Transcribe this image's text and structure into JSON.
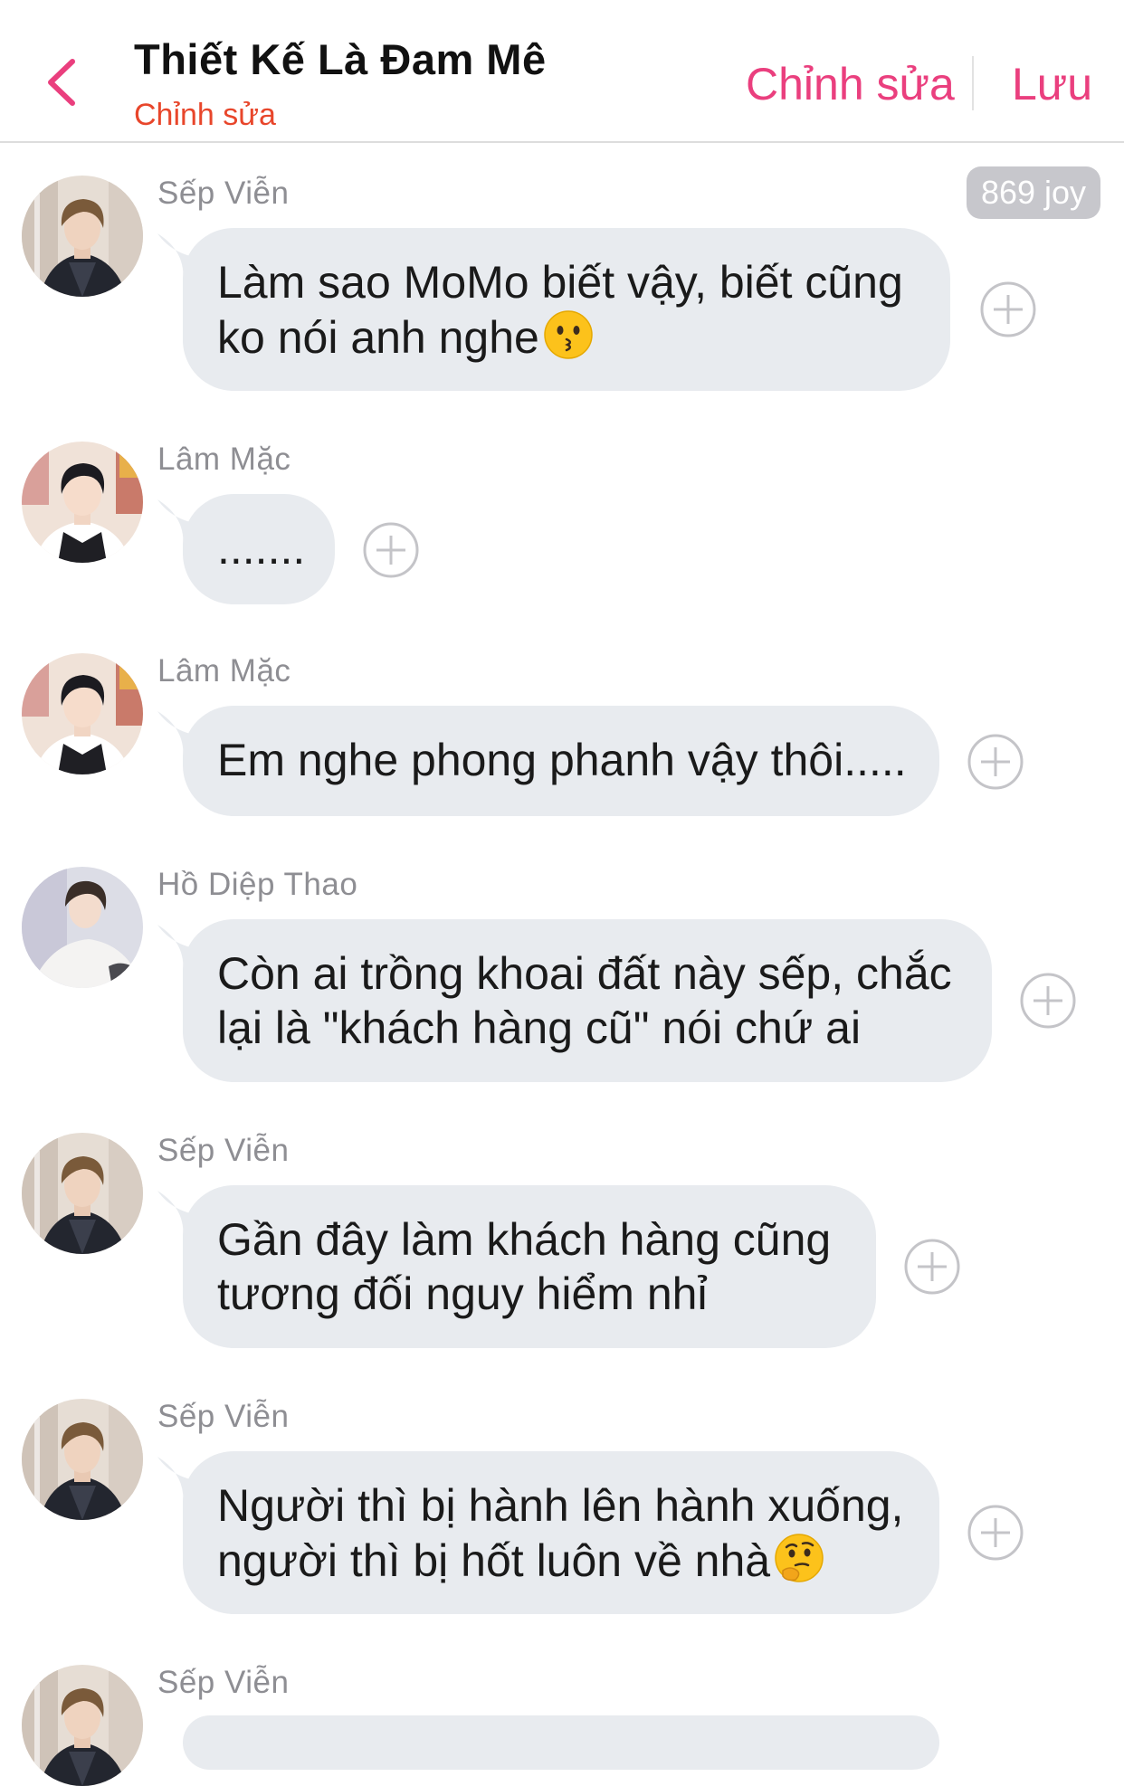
{
  "header": {
    "title": "Thiết Kế Là Đam Mê",
    "subtitle": "Chỉnh sửa",
    "edit_label": "Chỉnh sửa",
    "save_label": "Lưu",
    "back_icon": "chevron-left-icon",
    "accent_color": "#ea3f7e"
  },
  "messages": [
    {
      "sender": "Sếp Viễn",
      "lines": [
        "Làm sao MoMo biết vậy, biết cũng",
        "ko nói anh nghe"
      ],
      "emoji": "kissing-face-emoji",
      "badge": "869 joy"
    },
    {
      "sender": "Lâm Mặc",
      "lines": [
        "......."
      ]
    },
    {
      "sender": "Lâm Mặc",
      "lines": [
        "Em nghe phong phanh vậy thôi....."
      ]
    },
    {
      "sender": "Hồ Diệp Thao",
      "lines": [
        "Còn ai trồng khoai đất này sếp, chắc",
        "lại là \"khách hàng cũ\" nói chứ ai"
      ]
    },
    {
      "sender": "Sếp Viễn",
      "lines": [
        "Gần đây làm khách hàng cũng",
        "tương đối nguy hiểm nhỉ"
      ]
    },
    {
      "sender": "Sếp Viễn",
      "lines": [
        "Người thì bị hành lên hành xuống,",
        "người thì bị hốt luôn về nhà"
      ],
      "emoji": "thinking-face-emoji"
    },
    {
      "sender": "Sếp Viễn",
      "lines": []
    }
  ],
  "icons": {
    "add_reaction": "plus-circle-icon"
  },
  "colors": {
    "bubble": "#e8ebef",
    "sender": "#8e8e93",
    "badge": "#c7c7cc",
    "subtitle": "#e8462b"
  }
}
